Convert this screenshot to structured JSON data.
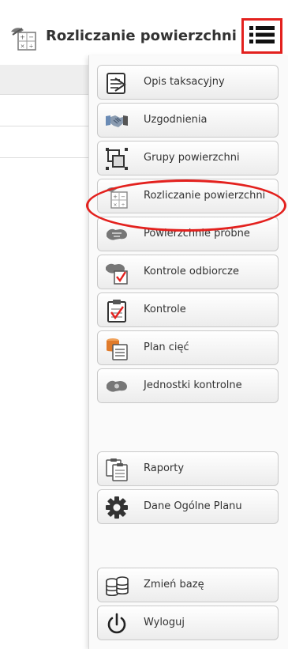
{
  "header": {
    "title": "Rozliczanie powierzchni",
    "title_icon": "calculator-icon",
    "menu_button_icon": "hamburger-list-icon"
  },
  "menu": {
    "items": [
      {
        "label": "Opis taksacyjny",
        "icon": "clipboard-pencil-icon"
      },
      {
        "label": "Uzgodnienia",
        "icon": "handshake-icon"
      },
      {
        "label": "Grupy powierzchni",
        "icon": "group-selection-icon"
      },
      {
        "label": "Rozliczanie powierzchni",
        "icon": "calculator-icon",
        "highlighted": true
      },
      {
        "label": "Powierzchnie próbne",
        "icon": "sample-plot-icon"
      },
      {
        "label": "Kontrole odbiorcze",
        "icon": "acceptance-check-icon"
      },
      {
        "label": "Kontrole",
        "icon": "clipboard-check-icon"
      },
      {
        "label": "Plan cięć",
        "icon": "log-document-icon"
      },
      {
        "label": "Jednostki kontrolne",
        "icon": "control-unit-icon"
      },
      {
        "label": "Raporty",
        "icon": "reports-icon"
      },
      {
        "label": "Dane Ogólne Planu",
        "icon": "gear-icon"
      },
      {
        "label": "Zmień bazę",
        "icon": "database-switch-icon"
      },
      {
        "label": "Wyloguj",
        "icon": "power-icon"
      }
    ]
  },
  "colors": {
    "highlight_red": "#e3211e",
    "text": "#333333",
    "button_border": "#c9c9c9",
    "icon_gray": "#555555",
    "icon_blue": "#6a8bb5",
    "icon_orange": "#e07b2b"
  }
}
